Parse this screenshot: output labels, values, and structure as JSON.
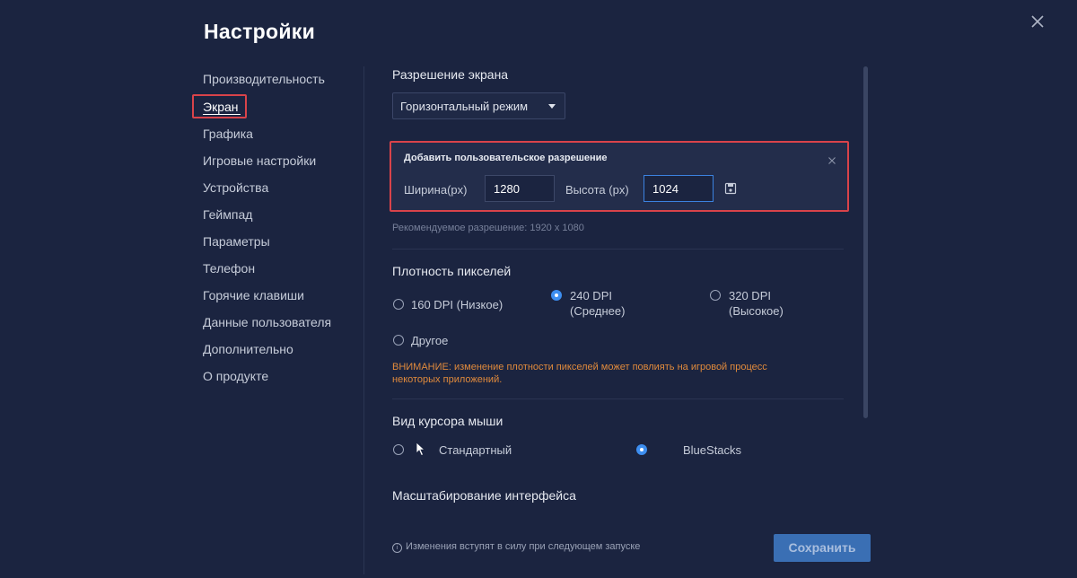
{
  "window": {
    "title": "Настройки",
    "close_icon": "close-icon"
  },
  "sidebar": {
    "items": [
      {
        "label": "Производительность",
        "active": false
      },
      {
        "label": "Экран",
        "active": true
      },
      {
        "label": "Графика",
        "active": false
      },
      {
        "label": "Игровые настройки",
        "active": false
      },
      {
        "label": "Устройства",
        "active": false
      },
      {
        "label": "Геймпад",
        "active": false
      },
      {
        "label": "Параметры",
        "active": false
      },
      {
        "label": "Телефон",
        "active": false
      },
      {
        "label": "Горячие клавиши",
        "active": false
      },
      {
        "label": "Данные пользователя",
        "active": false
      },
      {
        "label": "Дополнительно",
        "active": false
      },
      {
        "label": "О продукте",
        "active": false
      }
    ]
  },
  "resolution": {
    "heading": "Разрешение экрана",
    "orientation_selected": "Горизонтальный режим",
    "custom": {
      "title": "Добавить пользовательское разрешение",
      "width_label": "Ширина(px)",
      "width_value": "1280",
      "height_label": "Высота (px)",
      "height_value": "1024",
      "save_icon": "save-icon",
      "close_icon": "close-icon"
    },
    "recommended": "Рекомендуемое разрешение: 1920 x 1080"
  },
  "dpi": {
    "heading": "Плотность пикселей",
    "options": [
      {
        "line1": "160 DPI (Низкое)",
        "line2": "",
        "checked": false
      },
      {
        "line1": "240 DPI",
        "line2": "(Среднее)",
        "checked": true
      },
      {
        "line1": "320 DPI",
        "line2": "(Высокое)",
        "checked": false
      },
      {
        "line1": "Другое",
        "line2": "",
        "checked": false
      }
    ],
    "warning_line1": "ВНИМАНИЕ: изменение плотности пикселей может повлиять на игровой процесс",
    "warning_line2": "некоторых приложений."
  },
  "cursor": {
    "heading": "Вид курсора мыши",
    "options": [
      {
        "label": "Стандартный",
        "checked": false,
        "icon": "arrow-cursor-icon"
      },
      {
        "label": "BlueStacks",
        "checked": true
      }
    ]
  },
  "scaling": {
    "heading": "Масштабирование интерфейса"
  },
  "footer": {
    "info_icon": "info-icon",
    "info_text": "Изменения вступят в силу при следующем запуске",
    "save_label": "Сохранить"
  },
  "colors": {
    "background": "#1b2440",
    "accent_blue": "#3d8ef0",
    "highlight_red": "#d9434a",
    "warning_orange": "#e08a3c",
    "save_button": "#3a6fb4"
  }
}
